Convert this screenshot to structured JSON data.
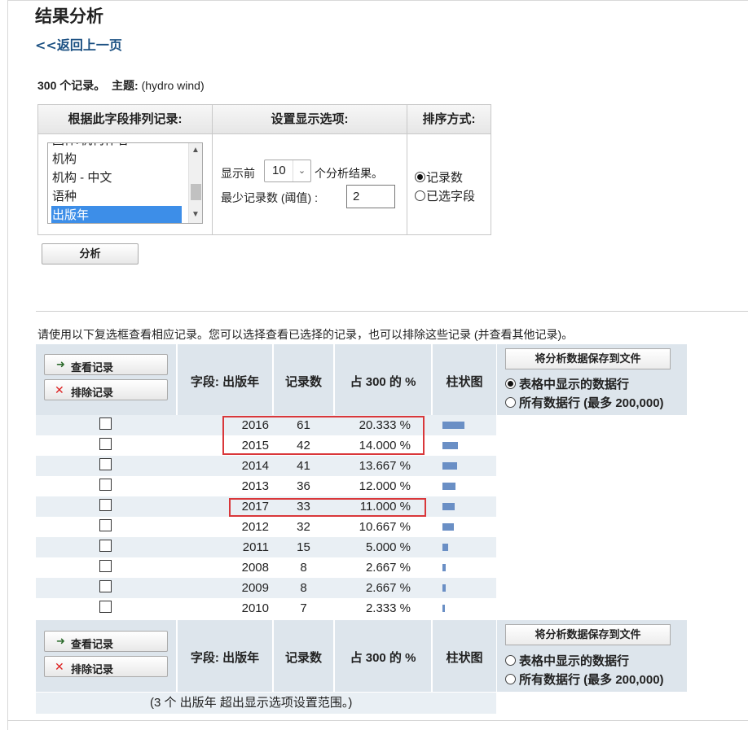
{
  "page": {
    "title": "结果分析",
    "back_link": "<<返回上一页",
    "summary_count": "300 个记录。",
    "summary_topic_label": "主题:",
    "summary_topic_value": " (hydro wind)"
  },
  "options": {
    "col1_header": "根据此字段排列记录:",
    "col2_header": "设置显示选项:",
    "col3_header": "排序方式:",
    "field_list": [
      "团体/机构作者",
      "机构",
      "机构 - 中文",
      "语种",
      "出版年"
    ],
    "selected_field": "出版年",
    "show_prefix": "显示前",
    "show_value": "10",
    "show_suffix": "个分析结果。",
    "min_label": "最少记录数 (阈值) :",
    "min_value": "2",
    "sort_by_count": "记录数",
    "sort_by_field": "已选字段",
    "analyze_button": "分析"
  },
  "note": "请使用以下复选框查看相应记录。您可以选择查看已选择的记录，也可以排除这些记录 (并查看其他记录)。",
  "table": {
    "view_button": "查看记录",
    "exclude_button": "排除记录",
    "col_field": "字段: 出版年",
    "col_count": "记录数",
    "col_percent": "占 300 的 %",
    "col_bar": "柱状图",
    "save_button": "将分析数据保存到文件",
    "save_option_shown": "表格中显示的数据行",
    "save_option_all": "所有数据行 (最多 200,000)",
    "rows": [
      {
        "year": "2016",
        "count": "61",
        "percent": "20.333 %",
        "fraction": 0.20333
      },
      {
        "year": "2015",
        "count": "42",
        "percent": "14.000 %",
        "fraction": 0.14
      },
      {
        "year": "2014",
        "count": "41",
        "percent": "13.667 %",
        "fraction": 0.13667
      },
      {
        "year": "2013",
        "count": "36",
        "percent": "12.000 %",
        "fraction": 0.12
      },
      {
        "year": "2017",
        "count": "33",
        "percent": "11.000 %",
        "fraction": 0.11
      },
      {
        "year": "2012",
        "count": "32",
        "percent": "10.667 %",
        "fraction": 0.10667
      },
      {
        "year": "2011",
        "count": "15",
        "percent": "5.000 %",
        "fraction": 0.05
      },
      {
        "year": "2008",
        "count": "8",
        "percent": "2.667 %",
        "fraction": 0.02667
      },
      {
        "year": "2009",
        "count": "8",
        "percent": "2.667 %",
        "fraction": 0.02667
      },
      {
        "year": "2010",
        "count": "7",
        "percent": "2.333 %",
        "fraction": 0.02333
      }
    ],
    "footer": "(3 个 出版年 超出显示选项设置范围。)"
  },
  "colors": {
    "bar": "#6a8fc5",
    "highlight_box": "#d9373a",
    "header_bg": "#dde5ec",
    "link": "#1b5082"
  }
}
